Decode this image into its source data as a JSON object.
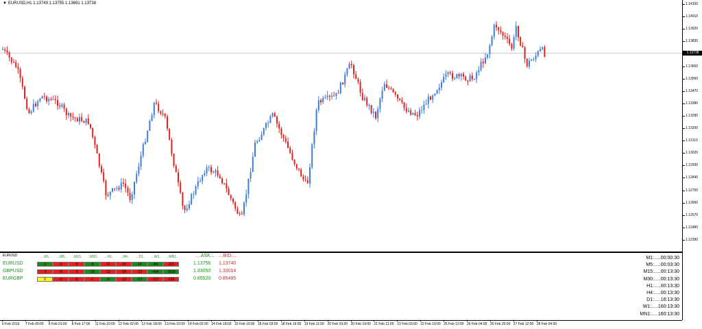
{
  "chart": {
    "header": "EURUSD,H1  1.13749 1.13755 1.13691 1.13738",
    "current_price": "1.13738",
    "up_color": "#3b7dd8",
    "down_color": "#e02020",
    "price_levels": [
      "1.14100",
      "1.14010",
      "1.13920",
      "1.13830",
      "1.13650",
      "1.13560",
      "1.13470",
      "1.13380",
      "1.13290",
      "1.13200",
      "1.13110",
      "1.13020",
      "1.12930",
      "1.12840",
      "1.12750",
      "1.12660",
      "1.12570",
      "1.12480",
      "1.12390"
    ],
    "time_labels": [
      "6 Feb 2019",
      "7 Feb 09:00",
      "8 Feb 01:00",
      "8 Feb 17:00",
      "11 Feb 10:00",
      "12 Feb 02:00",
      "12 Feb 18:00",
      "13 Feb 10:00",
      "14 Feb 02:00",
      "14 Feb 18:00",
      "15 Feb 10:00",
      "18 Feb 03:00",
      "18 Feb 19:00",
      "19 Feb 11:00",
      "20 Feb 03:00",
      "20 Feb 19:00",
      "21 Feb 11:00",
      "22 Feb 03:00",
      "22 Feb 19:00",
      "25 Feb 12:00",
      "26 Feb 04:00",
      "26 Feb 20:00",
      "27 Feb 12:00",
      "28 Feb 04:00"
    ]
  },
  "indicator": {
    "title": "EURUSD",
    "timeframe_headers": [
      "...M1..",
      "...M5..",
      "..M15..",
      "..M30..",
      "...H1..",
      "...H4..",
      "...D1..",
      "...W1..",
      "...MN1.."
    ],
    "ask_header": "....ASK....",
    "bid_header": "....BID....",
    "rows": [
      {
        "symbol": "EURUSD",
        "cells": [
          {
            "v": "3",
            "c": "#1a8a1a"
          },
          {
            "v": "-3",
            "c": "#ee1c1c"
          },
          {
            "v": "-5",
            "c": "#ee1c1c"
          },
          {
            "v": "-8",
            "c": "#1a8a1a"
          },
          {
            "v": "-11",
            "c": "#ee1c1c"
          },
          {
            "v": "-20",
            "c": "#ee1c1c"
          },
          {
            "v": "14",
            "c": "#1a8a1a"
          },
          {
            "v": "-84",
            "c": "#1a8a1a"
          },
          {
            "v": "-237",
            "c": "#ee1c1c"
          }
        ],
        "ask": "1.13756",
        "bid": "1.13740"
      },
      {
        "symbol": "GBPUSD",
        "cells": [
          {
            "v": "-1",
            "c": "#ee1c1c"
          },
          {
            "v": "-8",
            "c": "#ee1c1c"
          },
          {
            "v": "-3",
            "c": "#ee1c1c"
          },
          {
            "v": "-15",
            "c": "#1a8a1a"
          },
          {
            "v": "-22",
            "c": "#ee1c1c"
          },
          {
            "v": "-18",
            "c": "#ee1c1c"
          },
          {
            "v": "-12",
            "c": "#ee1c1c"
          },
          {
            "v": "-404",
            "c": "#1a8a1a"
          },
          {
            "v": "-1036",
            "c": "#1a8a1a"
          }
        ],
        "ask": "1.33050",
        "bid": "1.33014"
      },
      {
        "symbol": "EURGBP",
        "cells": [
          {
            "v": "0",
            "c": "#ffff00"
          },
          {
            "v": "-2",
            "c": "#ee1c1c"
          },
          {
            "v": "-5",
            "c": "#ee1c1c"
          },
          {
            "v": "-7",
            "c": "#ee1c1c"
          },
          {
            "v": "-6",
            "c": "#1a8a1a"
          },
          {
            "v": "-13",
            "c": "#ee1c1c"
          },
          {
            "v": "-17",
            "c": "#1a8a1a"
          },
          {
            "v": "-127",
            "c": "#ee1c1c"
          },
          {
            "v": "-165",
            "c": "#ee1c1c"
          }
        ],
        "ask": "0.85520",
        "bid": "0.85485"
      }
    ],
    "countdown": [
      "M1:.....00:00:30",
      "M5:.....00:03:30",
      "M15:.....00:13:30",
      "M30:.....00:13:30",
      "H1:.....00:13:30",
      "H4:.....00:13:30",
      "D1:.....16:13:30",
      "W1:.....160:13:30",
      "MN1:.....160:13:30"
    ]
  }
}
